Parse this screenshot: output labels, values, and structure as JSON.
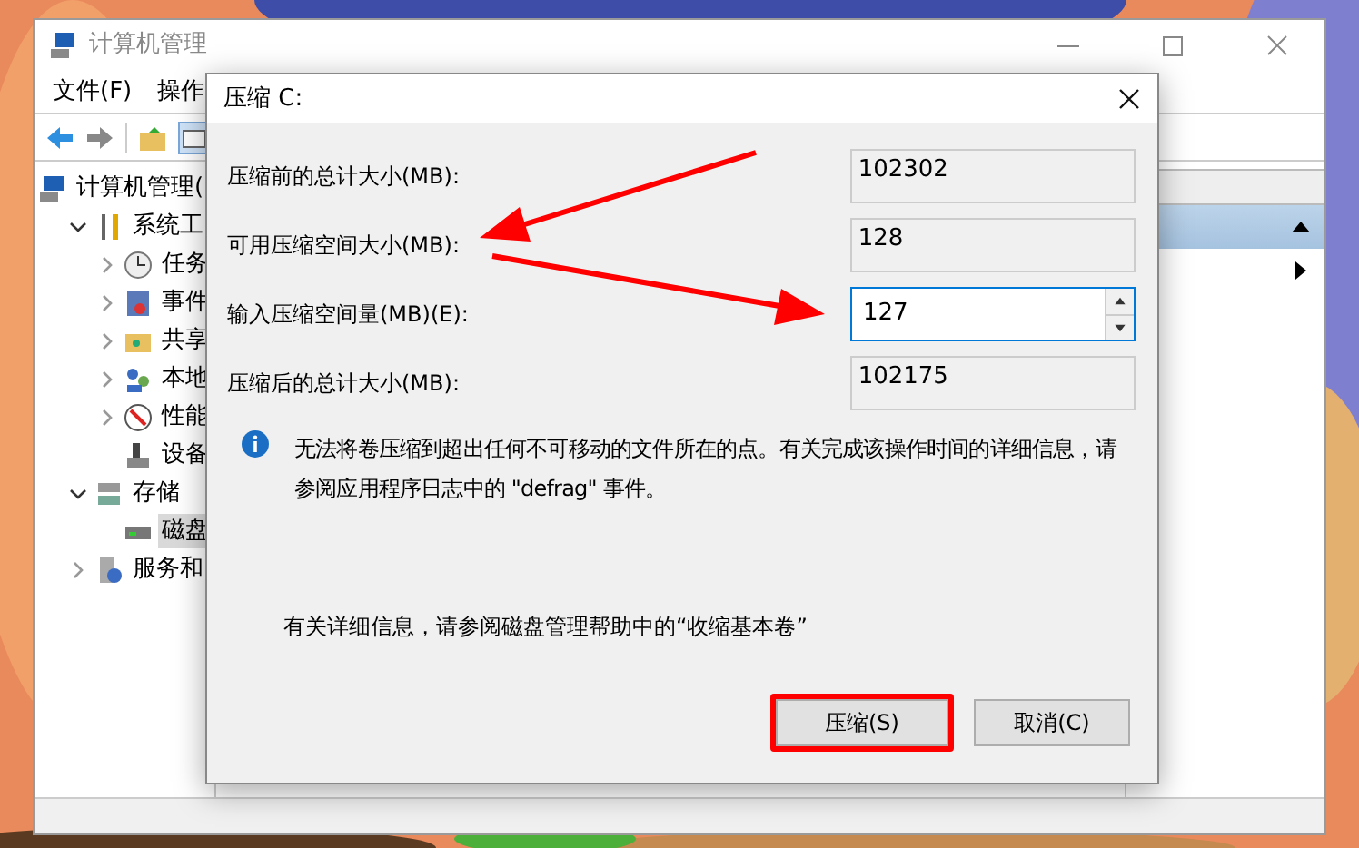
{
  "main_window": {
    "title": "计算机管理",
    "menu": [
      "文件(F)",
      "操作"
    ],
    "tree": [
      {
        "label": "计算机管理(",
        "selected": false,
        "children": [
          {
            "label": "系统工",
            "selected": false,
            "expanded": true,
            "children": [
              {
                "label": "任务",
                "selected": false,
                "expanded": false
              },
              {
                "label": "事件",
                "selected": false,
                "expanded": false
              },
              {
                "label": "共享",
                "selected": false,
                "expanded": false
              },
              {
                "label": "本地",
                "selected": false,
                "expanded": false
              },
              {
                "label": "性能",
                "selected": false,
                "expanded": false
              },
              {
                "label": "设备",
                "selected": false
              }
            ]
          },
          {
            "label": "存储",
            "selected": false,
            "expanded": true,
            "children": [
              {
                "label": "磁盘",
                "selected": true
              }
            ]
          },
          {
            "label": "服务和",
            "selected": false,
            "expanded": false
          }
        ]
      }
    ]
  },
  "dialog": {
    "title": "压缩 C:",
    "fields": [
      {
        "label": "压缩前的总计大小(MB):",
        "value": "102302",
        "kind": "readonly"
      },
      {
        "label": "可用压缩空间大小(MB):",
        "value": "128",
        "kind": "readonly"
      },
      {
        "label": "输入压缩空间量(MB)(E):",
        "value": "127",
        "kind": "spin"
      },
      {
        "label": "压缩后的总计大小(MB):",
        "value": "102175",
        "kind": "readonly"
      }
    ],
    "info": "无法将卷压缩到超出任何不可移动的文件所在的点。有关完成该操作时间的详细信息，请参阅应用程序日志中的 \"defrag\" 事件。",
    "help": "有关详细信息，请参阅磁盘管理帮助中的“收缩基本卷”",
    "buttons": [
      {
        "label": "压缩(S)",
        "highlighted": true
      },
      {
        "label": "取消(C)",
        "highlighted": false
      }
    ]
  }
}
